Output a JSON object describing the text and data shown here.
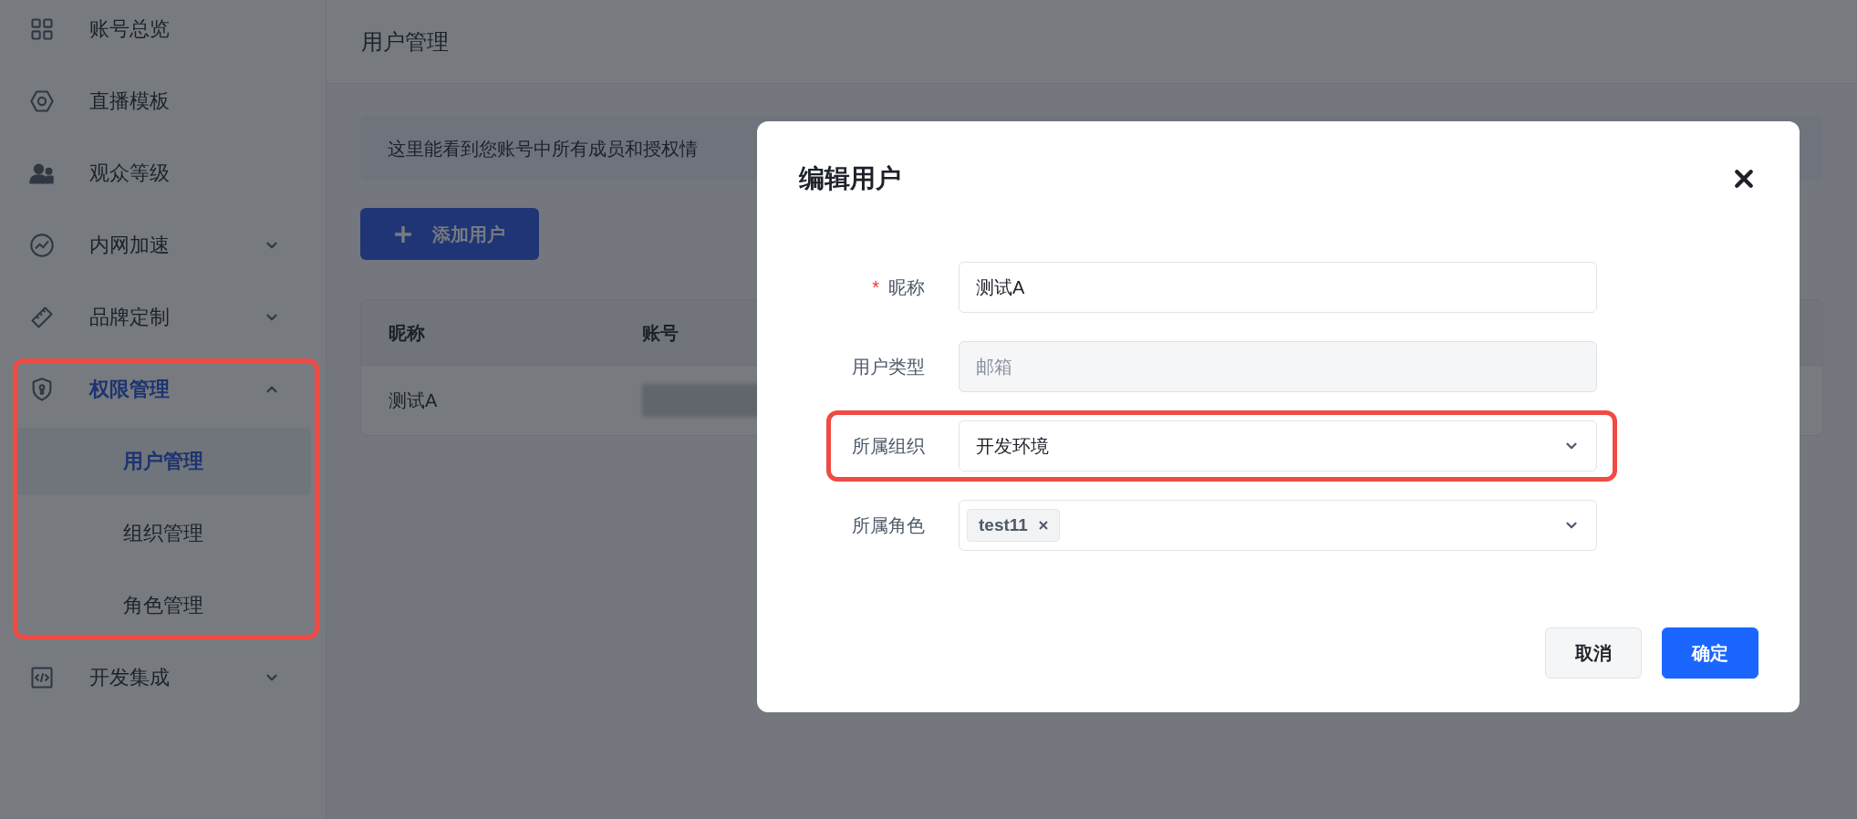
{
  "sidebar": {
    "items": [
      {
        "kind": "link",
        "label": "账号总览",
        "selected": false
      },
      {
        "kind": "link",
        "label": "直播模板",
        "selected": false
      },
      {
        "kind": "link",
        "label": "观众等级",
        "selected": false
      },
      {
        "kind": "group",
        "label": "内网加速",
        "selected": false,
        "expanded": false,
        "highlighted": false
      },
      {
        "kind": "group",
        "label": "品牌定制",
        "selected": false,
        "expanded": false,
        "highlighted": false
      },
      {
        "kind": "group",
        "label": "权限管理",
        "selected": true,
        "expanded": true,
        "highlighted": true,
        "children": [
          {
            "label": "用户管理",
            "selected": true
          },
          {
            "label": "组织管理",
            "selected": false
          },
          {
            "label": "角色管理",
            "selected": false
          }
        ]
      },
      {
        "kind": "group",
        "label": "开发集成",
        "selected": false,
        "expanded": false,
        "highlighted": false
      }
    ]
  },
  "page": {
    "title": "用户管理",
    "notice": "这里能看到您账号中所有成员和授权情",
    "add_button": "添加用户",
    "table": {
      "columns": [
        "昵称",
        "账号"
      ],
      "rows": [
        {
          "cells": [
            "测试A"
          ],
          "account_blurred": true
        }
      ]
    }
  },
  "dialog": {
    "title": "编辑用户",
    "fields": [
      {
        "kind": "text",
        "required_mark": "*",
        "label": "昵称",
        "value": "测试A",
        "highlighted": false
      },
      {
        "kind": "disabled",
        "label": "用户类型",
        "placeholder": "邮箱",
        "highlighted": false
      },
      {
        "kind": "select",
        "label": "所属组织",
        "value": "开发环境",
        "highlighted": true
      },
      {
        "kind": "tags",
        "label": "所属角色",
        "tags": [
          "test11"
        ],
        "highlighted": false
      }
    ],
    "buttons": [
      {
        "kind": "secondary",
        "label": "取消"
      },
      {
        "kind": "primary",
        "label": "确定"
      }
    ]
  }
}
